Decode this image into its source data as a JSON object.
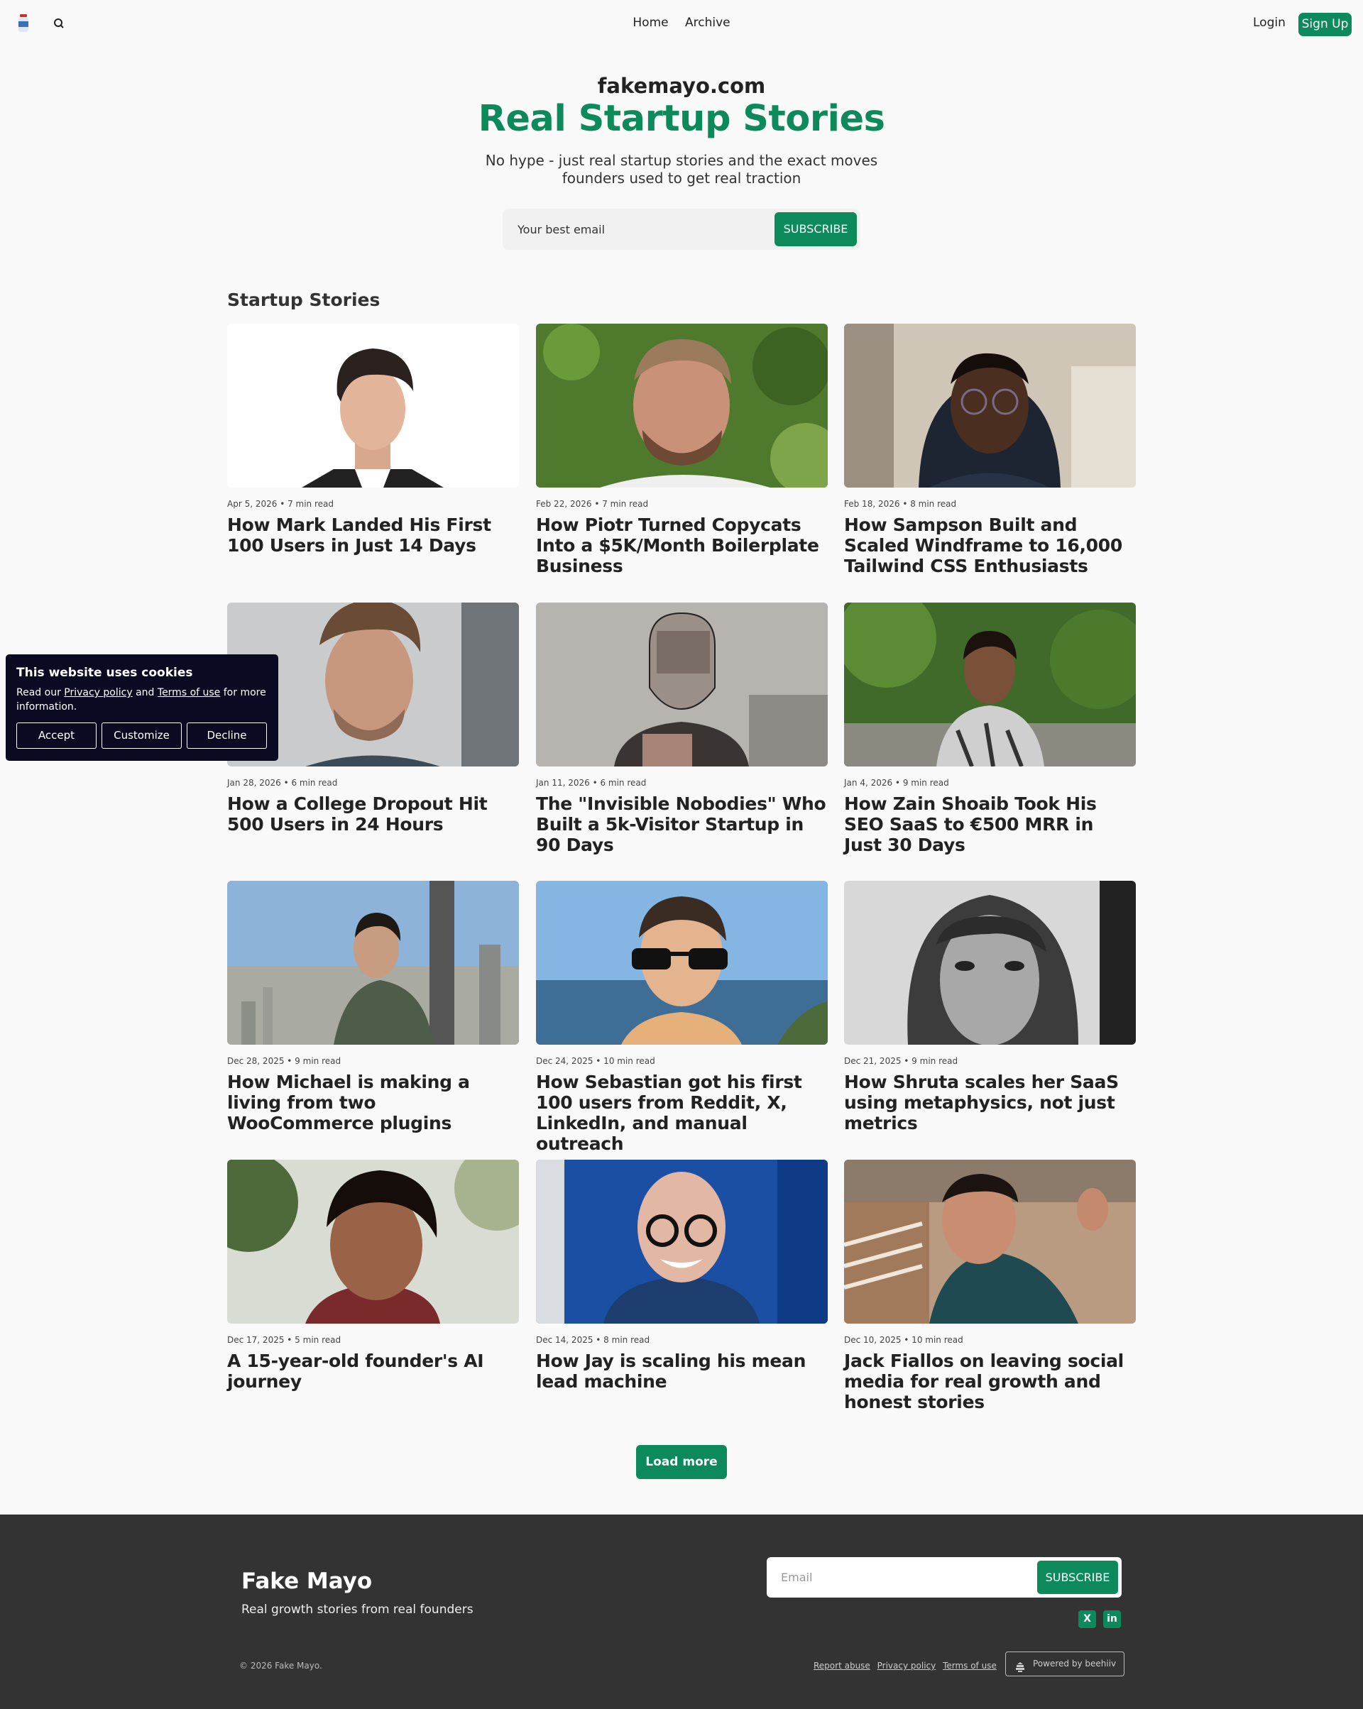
{
  "nav": {
    "links": [
      "Home",
      "Archive"
    ],
    "login": "Login",
    "signup": "Sign Up"
  },
  "hero": {
    "site_name": "fakemayo.com",
    "title": "Real Startup Stories",
    "subtitle": "No hype - just real startup stories and the exact moves founders used to get real traction",
    "email_placeholder": "Your best email",
    "subscribe": "SUBSCRIBE"
  },
  "section": {
    "title": "Startup Stories"
  },
  "posts": [
    {
      "meta": "Apr 5, 2026 • 7 min read",
      "title": "How Mark Landed His First 100 Users in Just 14 Days"
    },
    {
      "meta": "Feb 22, 2026 • 7 min read",
      "title": "How Piotr Turned Copycats Into a $5K/Month Boilerplate Business"
    },
    {
      "meta": "Feb 18, 2026 • 8 min read",
      "title": "How Sampson Built and Scaled Windframe to 16,000 Tailwind CSS Enthusiasts"
    },
    {
      "meta": "Jan 28, 2026 • 6 min read",
      "title": "How a College Dropout Hit 500 Users in 24 Hours"
    },
    {
      "meta": "Jan 11, 2026 • 6 min read",
      "title": "The \"Invisible Nobodies\" Who Built a 5k-Visitor Startup in 90 Days"
    },
    {
      "meta": "Jan 4, 2026 • 9 min read",
      "title": "How Zain Shoaib Took His SEO SaaS to €500 MRR in Just 30 Days"
    },
    {
      "meta": "Dec 28, 2025 • 9 min read",
      "title": "How Michael is making a living from two WooCommerce plugins"
    },
    {
      "meta": "Dec 24, 2025 • 10 min read",
      "title": "How Sebastian got his first 100 users from Reddit, X, LinkedIn, and manual outreach"
    },
    {
      "meta": "Dec 21, 2025 • 9 min read",
      "title": "How Shruta scales her SaaS using metaphysics, not just metrics"
    },
    {
      "meta": "Dec 17, 2025 • 5 min read",
      "title": "A 15-year-old founder's AI journey"
    },
    {
      "meta": "Dec 14, 2025 • 8 min read",
      "title": "How Jay is scaling his mean lead machine"
    },
    {
      "meta": "Dec 10, 2025 • 10 min read",
      "title": "Jack Fiallos on leaving social media for real growth and honest stories"
    }
  ],
  "load_more": "Load more",
  "cookie": {
    "heading": "This website uses cookies",
    "text_before": "Read our ",
    "privacy": "Privacy policy",
    "and": " and ",
    "terms": "Terms of use",
    "text_after": " for more information.",
    "accept": "Accept",
    "customize": "Customize",
    "decline": "Decline"
  },
  "footer": {
    "brand": "Fake Mayo",
    "tagline": "Real growth stories from real founders",
    "email_placeholder": "Email",
    "subscribe": "SUBSCRIBE",
    "social": [
      "X",
      "in"
    ],
    "copyright": "© 2026 Fake Mayo.",
    "links": [
      "Report abuse",
      "Privacy policy",
      "Terms of use"
    ],
    "powered": "Powered by beehiiv"
  },
  "colors": {
    "accent": "#0c8a5c",
    "cookie_bg": "#0a0a23",
    "footer_bg": "#333333"
  }
}
